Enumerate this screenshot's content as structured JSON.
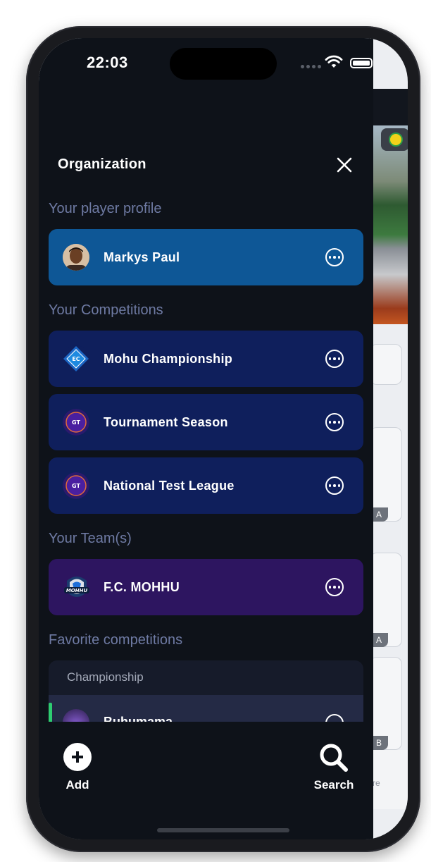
{
  "status_bar": {
    "time": "22:03"
  },
  "drawer": {
    "title": "Organization",
    "close_icon": "close-icon",
    "sections": {
      "player_profile": {
        "title": "Your player profile",
        "items": [
          {
            "label": "Markys Paul",
            "icon": "player-avatar"
          }
        ]
      },
      "competitions": {
        "title": "Your Competitions",
        "items": [
          {
            "label": "Mohu Championship",
            "icon": "ec-logo",
            "logo_text": "EC"
          },
          {
            "label": "Tournament Season",
            "icon": "gt-logo",
            "logo_text": "GT"
          },
          {
            "label": "National Test League",
            "icon": "gt-logo",
            "logo_text": "GT"
          }
        ]
      },
      "teams": {
        "title": "Your Team(s)",
        "items": [
          {
            "label": "F.C. MOHHU",
            "icon": "team-logo",
            "logo_text": "MOHHU"
          }
        ]
      },
      "favorites": {
        "title": "Favorite competitions",
        "group": "Championship",
        "items": [
          {
            "label": "Buhumama"
          }
        ]
      }
    }
  },
  "bottom_bar": {
    "add_label": "Add",
    "search_label": "Search"
  },
  "background": {
    "tag_a1": "A",
    "tag_a2": "A",
    "tag_b": "B",
    "footer_text": "re"
  },
  "colors": {
    "drawer_bg": "#0e1219",
    "profile_row": "#0e5796",
    "competition_row": "#0f1f5c",
    "team_row": "#2d1560",
    "section_title": "#6e7aa3",
    "favorite_accent": "#2ecc71"
  }
}
